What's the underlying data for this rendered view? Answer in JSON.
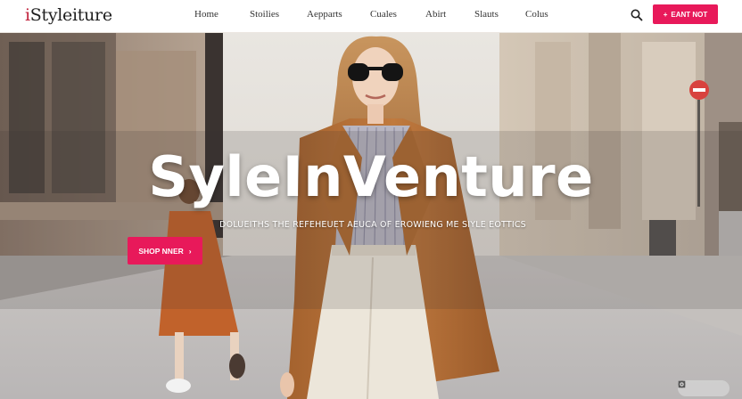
{
  "brand": {
    "logo_lead": "i",
    "logo_rest": "Styleiture"
  },
  "nav": {
    "items": [
      {
        "label": "Home"
      },
      {
        "label": "Stoilies"
      },
      {
        "label": "Aepparts"
      },
      {
        "label": "Cuales"
      },
      {
        "label": "Abirt"
      },
      {
        "label": "Slauts"
      },
      {
        "label": "Colus"
      }
    ]
  },
  "header": {
    "cta_label": "EANT NOT",
    "cta_arrow": "+"
  },
  "hero": {
    "title": "SyleInVenture",
    "subtitle": "DOLUEITHS THE REFEHEUET AEUCA OF EROWIENG ME SIYLE EOTTICS",
    "cta_label": "SHOP NNER",
    "cta_arrow": "›"
  },
  "icons": {
    "search": "search-icon",
    "corner": [
      "settings-icon",
      "fullscreen-icon",
      "chat-icon"
    ]
  },
  "colors": {
    "accent": "#e8195a",
    "logo_accent": "#c0203a"
  }
}
